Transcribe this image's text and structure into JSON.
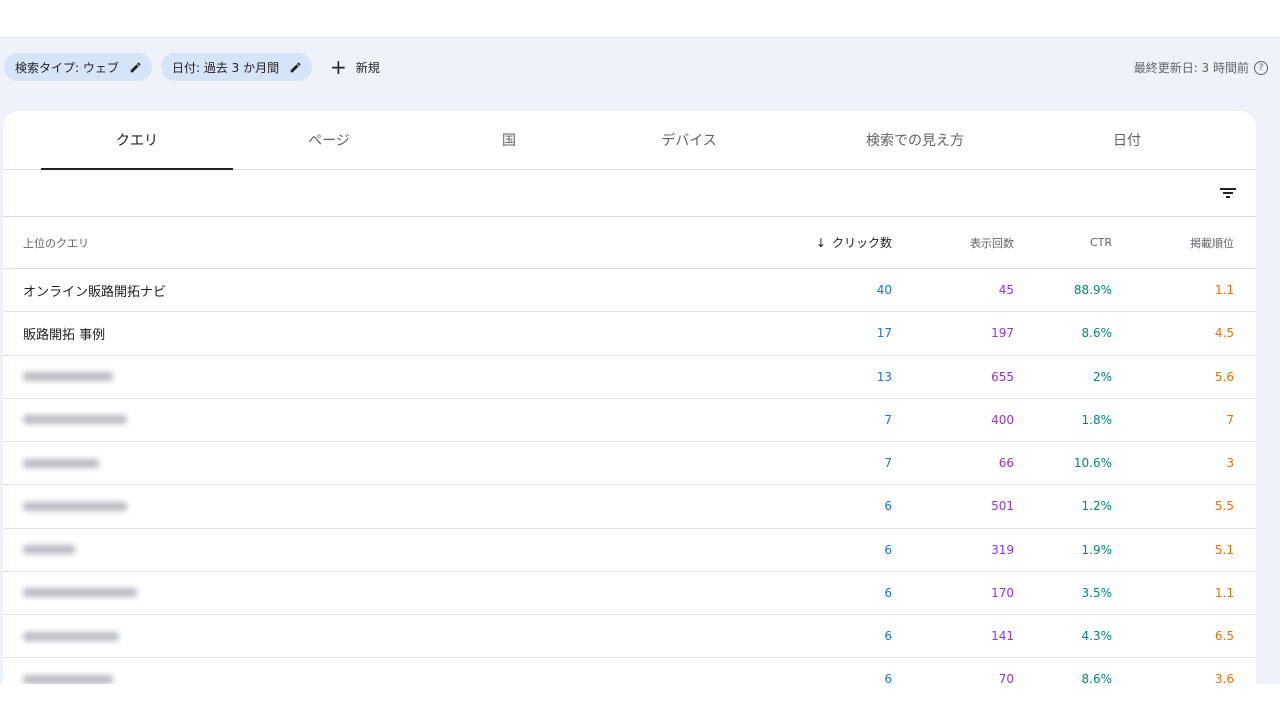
{
  "filters": {
    "chips": [
      {
        "label": "検索タイプ: ウェブ"
      },
      {
        "label": "日付: 過去 3 か月間"
      }
    ],
    "new_label": "新規",
    "last_updated": "最終更新日: 3 時間前"
  },
  "tabs": [
    {
      "label": "クエリ",
      "active": true
    },
    {
      "label": "ページ"
    },
    {
      "label": "国"
    },
    {
      "label": "デバイス"
    },
    {
      "label": "検索での見え方"
    },
    {
      "label": "日付"
    }
  ],
  "table": {
    "headers": {
      "query": "上位のクエリ",
      "clicks": "クリック数",
      "impressions": "表示回数",
      "ctr": "CTR",
      "position": "掲載順位"
    },
    "rows": [
      {
        "query": "オンライン販路開拓ナビ",
        "clicks": "40",
        "impressions": "45",
        "ctr": "88.9%",
        "position": "1.1"
      },
      {
        "query": "販路開拓 事例",
        "clicks": "17",
        "impressions": "197",
        "ctr": "8.6%",
        "position": "4.5"
      },
      {
        "query": "",
        "clicks": "13",
        "impressions": "655",
        "ctr": "2%",
        "position": "5.6"
      },
      {
        "query": "",
        "clicks": "7",
        "impressions": "400",
        "ctr": "1.8%",
        "position": "7"
      },
      {
        "query": "",
        "clicks": "7",
        "impressions": "66",
        "ctr": "10.6%",
        "position": "3"
      },
      {
        "query": "",
        "clicks": "6",
        "impressions": "501",
        "ctr": "1.2%",
        "position": "5.5"
      },
      {
        "query": "",
        "clicks": "6",
        "impressions": "319",
        "ctr": "1.9%",
        "position": "5.1"
      },
      {
        "query": "",
        "clicks": "6",
        "impressions": "170",
        "ctr": "3.5%",
        "position": "1.1"
      },
      {
        "query": "",
        "clicks": "6",
        "impressions": "141",
        "ctr": "4.3%",
        "position": "6.5"
      },
      {
        "query": "",
        "clicks": "6",
        "impressions": "70",
        "ctr": "8.6%",
        "position": "3.6"
      }
    ]
  },
  "colors": {
    "clicks": "#1a73e8",
    "impressions": "#9334e6",
    "ctr": "#00897b",
    "position": "#e8710a",
    "chip_bg": "#d7e3f8",
    "band_bg": "#eef3fb"
  },
  "icons": {
    "chip_edit": "pencil-icon",
    "new": "plus-icon",
    "help": "help-circle-icon",
    "filter": "filter-lines-icon",
    "sort": "arrow-down-icon"
  }
}
